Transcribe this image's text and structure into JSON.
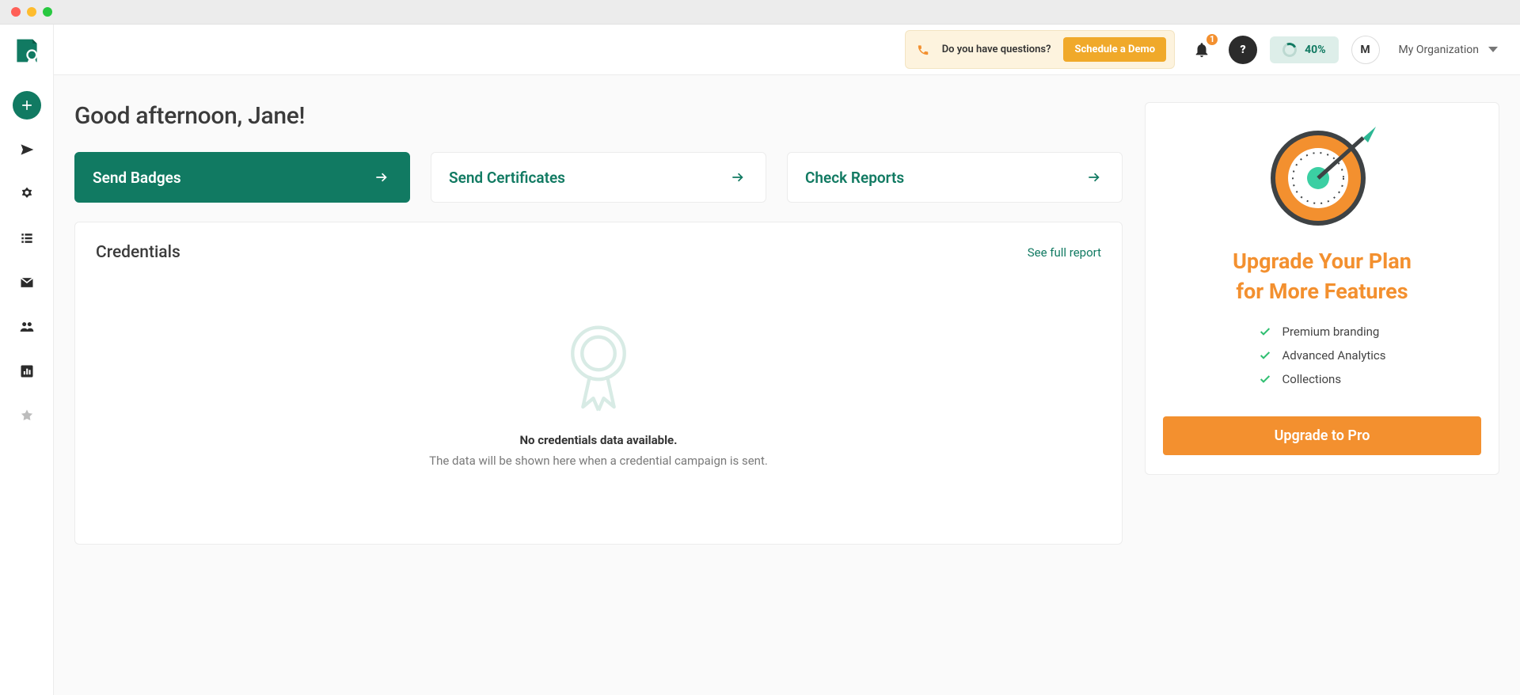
{
  "window": {
    "controls": [
      "close",
      "minimize",
      "zoom"
    ]
  },
  "sidebar": {
    "nav": [
      "add",
      "send",
      "badges",
      "list",
      "mail",
      "users",
      "analytics",
      "favorites"
    ]
  },
  "topbar": {
    "questions_label": "Do you have questions?",
    "demo_button": "Schedule a Demo",
    "notification_count": "1",
    "progress_percent": "40%",
    "avatar_initial": "M",
    "org_label": "My Organization"
  },
  "greeting": "Good afternoon, Jane!",
  "actions": {
    "primary": "Send Badges",
    "cert": "Send Certificates",
    "reports": "Check Reports"
  },
  "credentials_card": {
    "title": "Credentials",
    "link": "See full report",
    "empty_title": "No credentials data available.",
    "empty_sub": "The data will be shown here when a credential campaign is sent."
  },
  "upgrade_card": {
    "title_line1": "Upgrade Your Plan",
    "title_line2": "for More Features",
    "features": [
      "Premium branding",
      "Advanced Analytics",
      "Collections"
    ],
    "cta": "Upgrade to Pro"
  }
}
